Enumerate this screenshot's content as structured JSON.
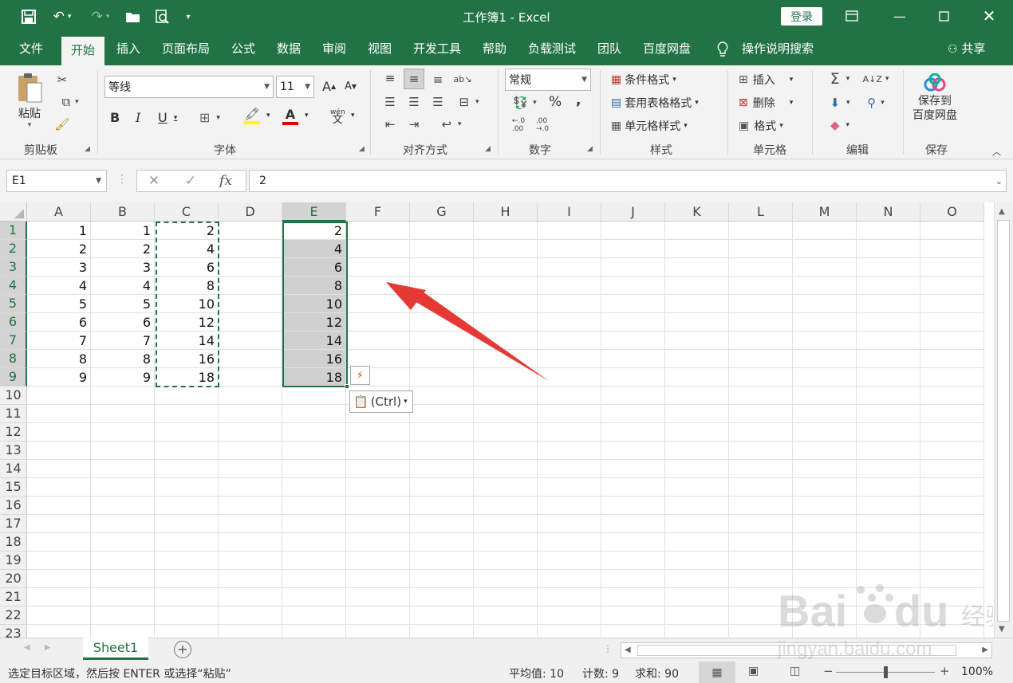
{
  "titlebar": {
    "title": "工作簿1 - Excel",
    "login": "登录",
    "quick_access": [
      "save-icon",
      "undo-icon",
      "redo-icon",
      "open-folder-icon",
      "print-preview-icon",
      "customize-icon"
    ]
  },
  "tabs": [
    "文件",
    "开始",
    "插入",
    "页面布局",
    "公式",
    "数据",
    "审阅",
    "视图",
    "开发工具",
    "帮助",
    "负载测试",
    "团队",
    "百度网盘",
    "操作说明搜索",
    "共享"
  ],
  "active_tab": "开始",
  "ribbon": {
    "clipboard": {
      "paste": "粘贴",
      "label": "剪贴板"
    },
    "font": {
      "name": "等线",
      "size": "11",
      "grow": "A",
      "shrink": "A",
      "bold": "B",
      "italic": "I",
      "underline": "U",
      "phonetic": "wén",
      "label": "字体"
    },
    "alignment": {
      "label": "对齐方式"
    },
    "number": {
      "format": "常规",
      "percent": "%",
      "comma": ",",
      "label": "数字"
    },
    "styles": {
      "conditional": "条件格式",
      "table": "套用表格格式",
      "cell": "单元格样式",
      "label": "样式"
    },
    "cells": {
      "insert": "插入",
      "delete": "删除",
      "format": "格式",
      "label": "单元格"
    },
    "editing": {
      "label": "编辑"
    },
    "save": {
      "button": "保存到\n百度网盘",
      "line1": "保存到",
      "line2": "百度网盘",
      "label": "保存"
    }
  },
  "formula_bar": {
    "name_box": "E1",
    "fx": "fx",
    "value": "2"
  },
  "grid": {
    "columns": [
      "A",
      "B",
      "C",
      "D",
      "E",
      "F",
      "G",
      "H",
      "I",
      "J",
      "K",
      "L",
      "M",
      "N",
      "O"
    ],
    "rows": [
      "1",
      "2",
      "3",
      "4",
      "5",
      "6",
      "7",
      "8",
      "9",
      "10",
      "11",
      "12",
      "13",
      "14",
      "15",
      "16",
      "17",
      "18",
      "19",
      "20",
      "21",
      "22",
      "23"
    ],
    "col_A": [
      "1",
      "2",
      "3",
      "4",
      "5",
      "6",
      "7",
      "8",
      "9"
    ],
    "col_B": [
      "1",
      "2",
      "3",
      "4",
      "5",
      "6",
      "7",
      "8",
      "9"
    ],
    "col_C": [
      "2",
      "4",
      "6",
      "8",
      "10",
      "12",
      "14",
      "16",
      "18"
    ],
    "col_E": [
      "2",
      "4",
      "6",
      "8",
      "10",
      "12",
      "14",
      "16",
      "18"
    ],
    "selected_column": "E",
    "paste_options": "(Ctrl)"
  },
  "sheets": {
    "active": "Sheet1"
  },
  "status": {
    "message": "选定目标区域，然后按 ENTER 或选择“粘贴”",
    "average": "平均值: 10",
    "count": "计数: 9",
    "sum": "求和: 90",
    "zoom": "100%"
  },
  "colors": {
    "accent": "#217346",
    "arrow": "#e53935"
  }
}
